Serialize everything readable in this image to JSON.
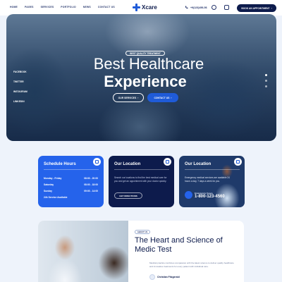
{
  "header": {
    "nav": [
      "HOME",
      "PAGES",
      "SERVICES",
      "PORTFOLIO",
      "NEWS",
      "CONTACT US"
    ],
    "logo_text": "Xcare",
    "phone": "+9(123)456-56",
    "cta_label": "BOOK AN APPOINTMENT"
  },
  "hero": {
    "badge": "BEST QUALITY TREATMENT",
    "title_line1": "Best Healthcare",
    "title_line2": "Experience",
    "button1": "OUR SERVICES",
    "button2": "CONTACT US",
    "side_links": [
      "FACEBOOK",
      "TWITTER",
      "INSTAGRAM",
      "LINKEDIN"
    ]
  },
  "cards": {
    "schedule": {
      "title": "Schedule Hours",
      "rows": [
        {
          "day": "Monday - Friday",
          "time": "08:00 - 20:00"
        },
        {
          "day": "Saturday",
          "time": "08:00 - 18:00"
        },
        {
          "day": "Sunday",
          "time": "09:00 - 14:00"
        },
        {
          "day": "24h Service Available",
          "time": ""
        }
      ]
    },
    "location": {
      "title": "Our Location",
      "text": "Search our locations to find the best medical care for you and get an appointment with your doctor quickly.",
      "button": "GET DIRECTIONS"
    },
    "location2": {
      "title": "Our Location",
      "text": "Emergency medical services are available 24 hours a day, 7 days a week for you.",
      "emergency_label": "Emergency Cases",
      "phone": "1-800-123-4560"
    }
  },
  "about": {
    "tag": "ABOUT US",
    "title_line1": "The Heart and Science of",
    "title_line2": "Medic Test",
    "paragraph": "Medical practice combines compassion with the latest science to deliver quality healthcare and innovative treatments for every patient with individual care.",
    "investigator": "Christian Fitzgerald"
  }
}
